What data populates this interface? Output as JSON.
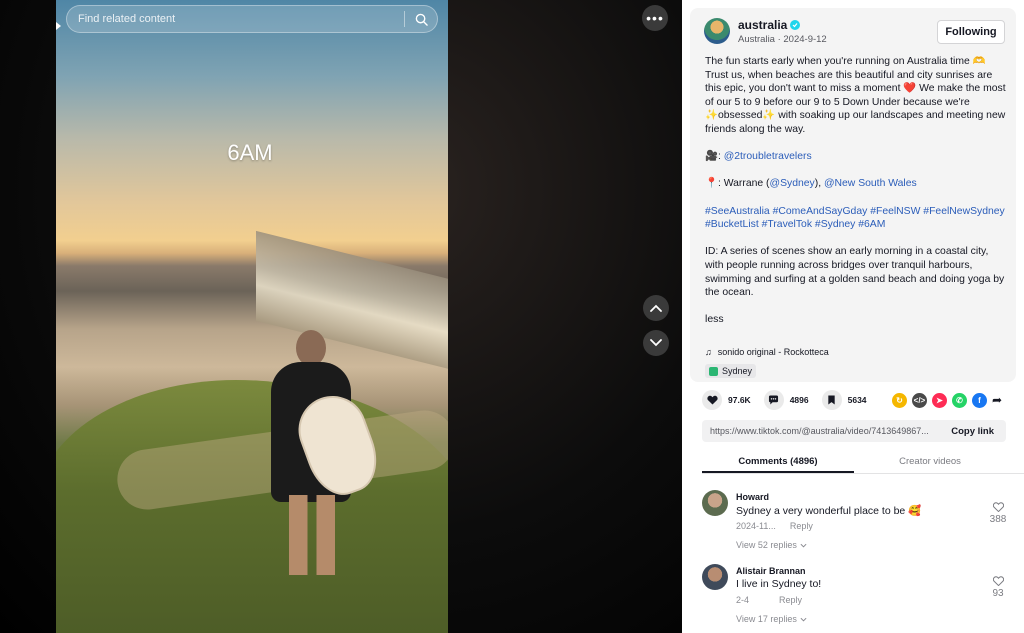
{
  "search": {
    "placeholder": "Find related content"
  },
  "video": {
    "overlay_text": "6AM"
  },
  "post": {
    "author": "australia",
    "meta": "Australia · 2024-9-12",
    "follow_label": "Following",
    "description": {
      "intro": "The fun starts early when you're running on Australia time 🫶 Trust us, when beaches are this beautiful and city sunrises are this epic, you don't want to miss a moment ❤️ We make the most of our 5 to 9 before our 9 to 5 Down Under because we're ✨obsessed✨ with soaking up our landscapes and meeting new friends along the way.",
      "credit_prefix": "🎥: ",
      "credit_handle": "@2troubletravelers",
      "location_prefix": "📍: Warrane (",
      "location_handle": "@Sydney",
      "location_mid": "), ",
      "location_tag": "@New South Wales",
      "hashtags": "#SeeAustralia #ComeAndSayGday #FeelNSW #FeelNewSydney #BucketList #TravelTok #Sydney #6AM",
      "image_desc": "ID: A series of scenes show an early morning in a coastal city, with people running across bridges over tranquil harbours, swimming and surfing at a golden sand beach and doing yoga by the ocean.",
      "less_label": "less"
    },
    "music": "sonido original - Rockotteca",
    "place": "Sydney"
  },
  "actions": {
    "likes": "97.6K",
    "comments": "4896",
    "saves": "5634"
  },
  "share_link": {
    "url": "https://www.tiktok.com/@australia/video/7413649867...",
    "copy_label": "Copy link"
  },
  "tabs": {
    "comments": "Comments (4896)",
    "creator": "Creator videos"
  },
  "comments": [
    {
      "name": "Howard",
      "text": "Sydney a very wonderful place to be 🥰",
      "date": "2024-11...",
      "reply": "Reply",
      "likes": "388",
      "view_replies": "View 52 replies"
    },
    {
      "name": "Alistair Brannan",
      "text": "I live in Sydney to!",
      "date": "2-4",
      "reply": "Reply",
      "likes": "93",
      "view_replies": "View 17 replies"
    }
  ],
  "colors": {
    "link": "#2b5db9",
    "verified": "#20d5ec",
    "heart": "#fe2c55"
  }
}
